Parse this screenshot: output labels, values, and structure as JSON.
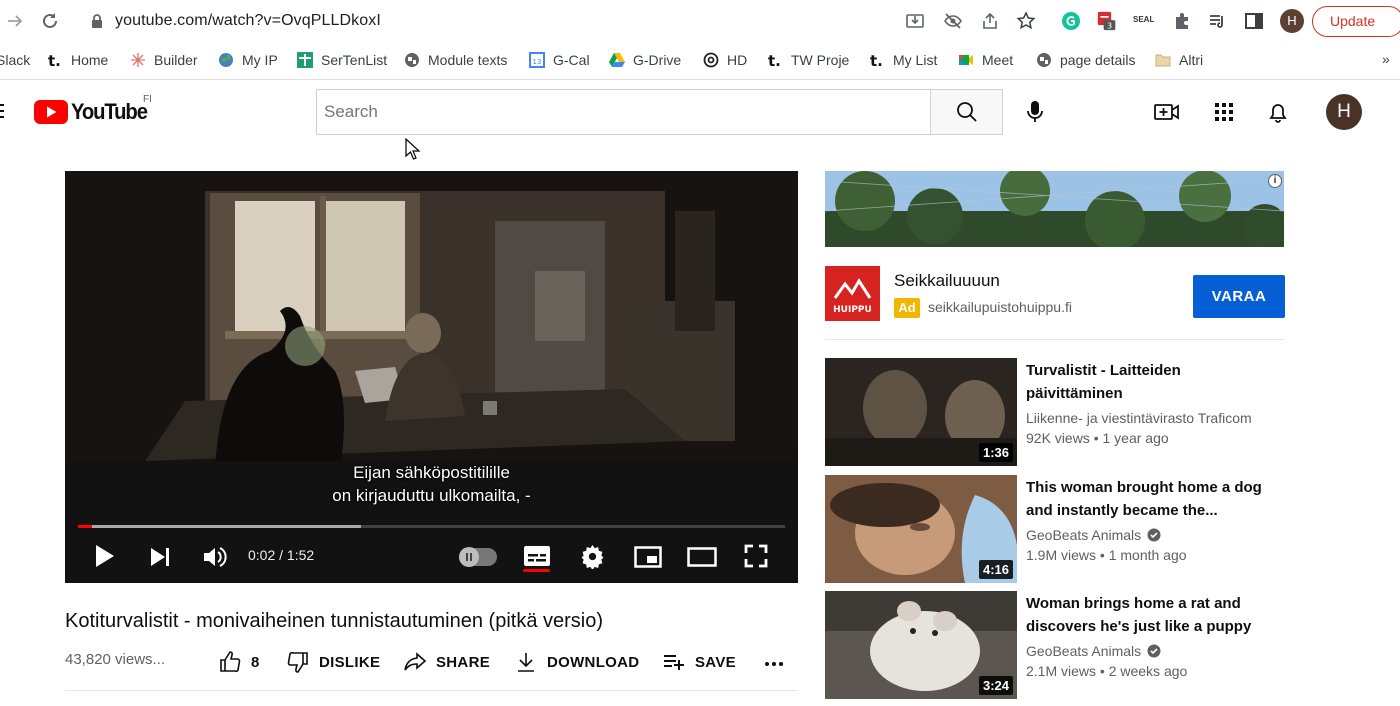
{
  "browser": {
    "url": "youtube.com/watch?v=OvqPLLDkoxI",
    "ext_badge": "3",
    "ext_label": "SEAL",
    "profile_initial": "H",
    "update_label": "Update",
    "bookmarks": [
      {
        "label": "Slack",
        "icon": "slack-icon"
      },
      {
        "label": "Home",
        "icon": "t-icon"
      },
      {
        "label": "Builder",
        "icon": "builder-icon"
      },
      {
        "label": "My IP",
        "icon": "globe-icon"
      },
      {
        "label": "SerTenList",
        "icon": "plus-icon"
      },
      {
        "label": "Module texts",
        "icon": "globe-icon"
      },
      {
        "label": "G-Cal",
        "icon": "calendar-icon"
      },
      {
        "label": "G-Drive",
        "icon": "drive-icon"
      },
      {
        "label": "HD",
        "icon": "hd-icon"
      },
      {
        "label": "TW Proje",
        "icon": "t-icon"
      },
      {
        "label": "My List",
        "icon": "t-icon"
      },
      {
        "label": "Meet",
        "icon": "meet-icon"
      },
      {
        "label": "page details",
        "icon": "globe-icon"
      },
      {
        "label": "Altri",
        "icon": "folder-icon"
      }
    ],
    "more": "»"
  },
  "youtube": {
    "logo_text": "YouTube",
    "country": "FI",
    "search_placeholder": "Search",
    "profile_initial": "H"
  },
  "player": {
    "subtitle_line1": "Eijan sähköpostitilille",
    "subtitle_line2": "on kirjauduttu ulkomailta, -",
    "time": "0:02 / 1:52",
    "progress_played": 0.02,
    "progress_buffered": 0.4
  },
  "video": {
    "title": "Kotiturvalistit - monivaiheinen tunnistautuminen (pitkä versio)",
    "views": "43,820 views...",
    "likes": "8",
    "dislike_label": "DISLIKE",
    "share_label": "SHARE",
    "download_label": "DOWNLOAD",
    "save_label": "SAVE"
  },
  "ad": {
    "title": "Seikkailuuuun",
    "badge": "Ad",
    "url": "seikkailupuistohuippu.fi",
    "cta": "VARAA",
    "logo_text": "HUIPPU"
  },
  "recommendations": [
    {
      "title": "Turvalistit - Laitteiden päivittäminen",
      "channel": "Liikenne- ja viestintävirasto Traficom",
      "verified": false,
      "meta": "92K views • 1 year ago",
      "duration": "1:36"
    },
    {
      "title": "This woman brought home a dog and instantly became the...",
      "channel": "GeoBeats Animals",
      "verified": true,
      "meta": "1.9M views • 1 month ago",
      "duration": "4:16"
    },
    {
      "title": "Woman brings home a rat and discovers he's just like a puppy",
      "channel": "GeoBeats Animals",
      "verified": true,
      "meta": "2.1M views • 2 weeks ago",
      "duration": "3:24"
    }
  ],
  "colors": {
    "accent_red": "#ff0000",
    "ad_button": "#065fd4",
    "ad_badge": "#f2b600",
    "update_red": "#d93025"
  }
}
